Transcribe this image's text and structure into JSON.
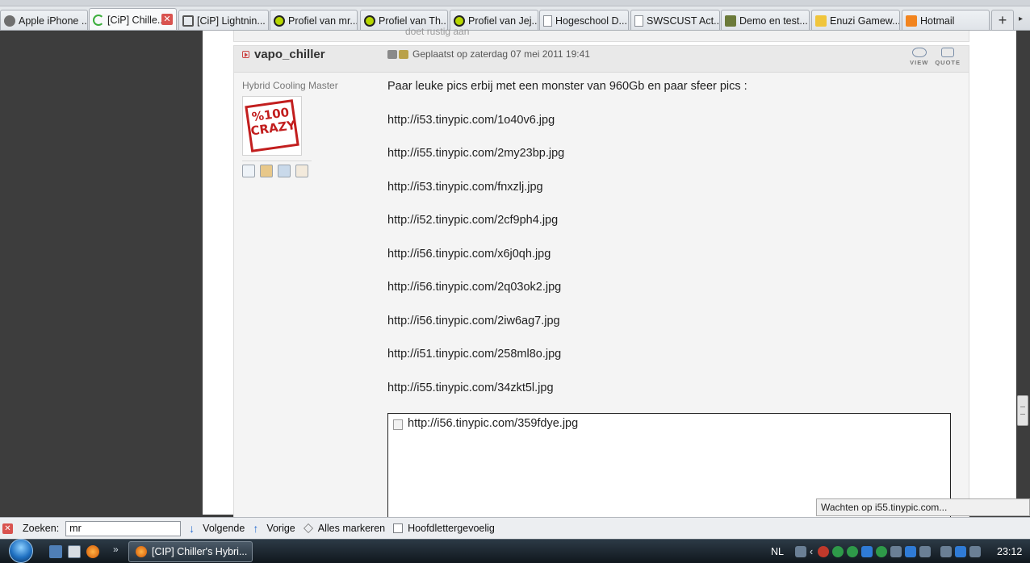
{
  "tabs": [
    {
      "label": "Apple iPhone ...",
      "icon": "apple-favicon-icon"
    },
    {
      "label": "[CiP] Chille...",
      "icon": "loading-spinner-icon",
      "active": true,
      "closable": true
    },
    {
      "label": "[CiP] Lightnin...",
      "icon": "wrench-favicon-icon"
    },
    {
      "label": "Profiel van mr...",
      "icon": "cip-favicon-icon"
    },
    {
      "label": "Profiel van Th...",
      "icon": "cip-favicon-icon"
    },
    {
      "label": "Profiel van Jej...",
      "icon": "cip-favicon-icon"
    },
    {
      "label": "Hogeschool D...",
      "icon": "page-icon"
    },
    {
      "label": "SWSCUST Act...",
      "icon": "page-icon"
    },
    {
      "label": "Demo en test...",
      "icon": "game-favicon-icon"
    },
    {
      "label": "Enuzi Gamew...",
      "icon": "enuzi-favicon-icon"
    },
    {
      "label": "Hotmail",
      "icon": "hotmail-favicon-icon"
    }
  ],
  "newtab_label": "+",
  "post": {
    "previous_text": "doet rustig aan",
    "username": "vapo_chiller",
    "posted": "Geplaatst op zaterdag 07 mei 2011 19:41",
    "view_label": "VIEW",
    "quote_label": "QUOTE",
    "rank": "Hybrid Cooling Master",
    "avatar_text": "%100 CRAZY",
    "body_intro": "Paar leuke pics erbij met een monster van 960Gb en paar sfeer pics :",
    "links": [
      "http://i53.tinypic.com/1o40v6.jpg",
      "http://i55.tinypic.com/2my23bp.jpg",
      "http://i53.tinypic.com/fnxzlj.jpg",
      "http://i52.tinypic.com/2cf9ph4.jpg",
      "http://i56.tinypic.com/x6j0qh.jpg",
      "http://i56.tinypic.com/2q03ok2.jpg",
      "http://i56.tinypic.com/2iw6ag7.jpg",
      "http://i51.tinypic.com/258ml8o.jpg",
      "http://i55.tinypic.com/34zkt5l.jpg"
    ],
    "image_placeholder_url": "http://i56.tinypic.com/359fdye.jpg"
  },
  "status_text": "Wachten op i55.tinypic.com...",
  "findbar": {
    "label": "Zoeken:",
    "value": "mr",
    "next_label": "Volgende",
    "prev_label": "Vorige",
    "highlight_label": "Alles markeren",
    "matchcase_label": "Hoofdlettergevoelig",
    "matchcase_checked": false
  },
  "taskbar": {
    "window_button": "[CIP] Chiller's Hybri...",
    "language": "NL",
    "clock": "23:12",
    "quicklaunch_more": "»"
  }
}
